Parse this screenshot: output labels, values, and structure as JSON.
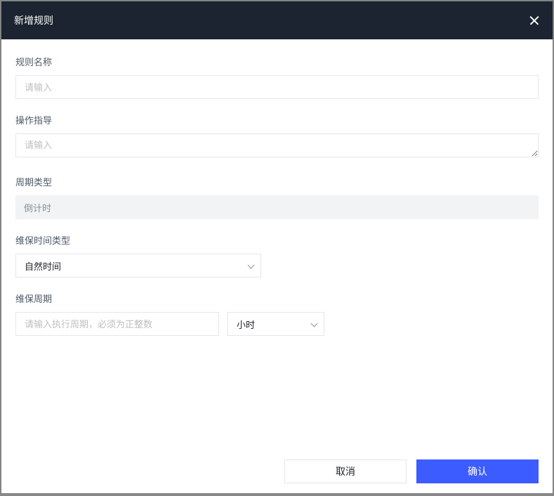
{
  "modal": {
    "title": "新增规则"
  },
  "form": {
    "ruleName": {
      "label": "规则名称",
      "placeholder": "请输入",
      "value": ""
    },
    "operationGuide": {
      "label": "操作指导",
      "placeholder": "请输入",
      "value": ""
    },
    "cycleType": {
      "label": "周期类型",
      "value": "倒计时"
    },
    "maintenanceTimeType": {
      "label": "维保时间类型",
      "selected": "自然时间"
    },
    "maintenanceCycle": {
      "label": "维保周期",
      "placeholder": "请输入执行周期，必须为正整数",
      "value": "",
      "unit": "小时"
    }
  },
  "footer": {
    "cancel": "取消",
    "confirm": "确认"
  }
}
